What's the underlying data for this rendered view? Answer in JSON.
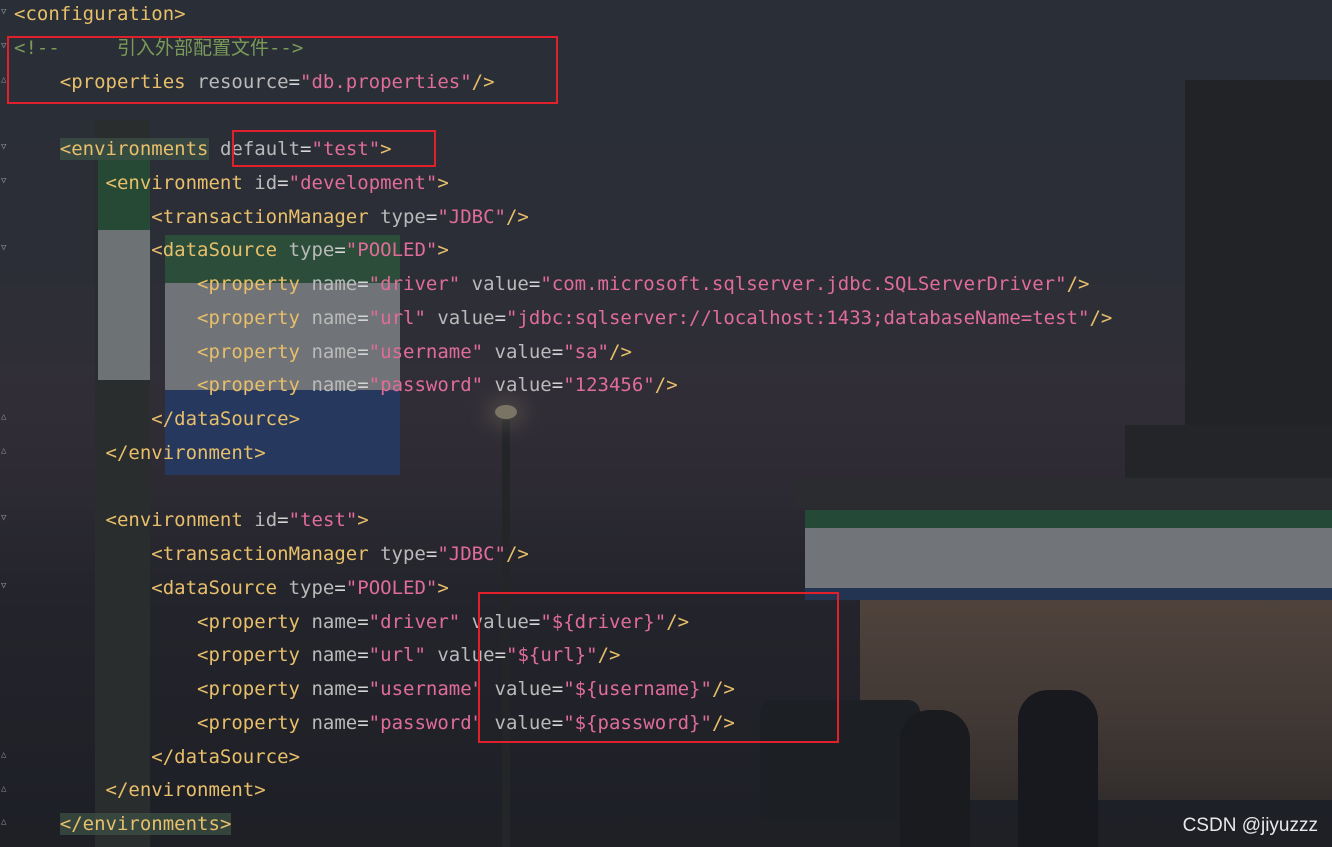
{
  "lines": [
    {
      "indent": 0,
      "open": "<",
      "tag": "configuration",
      "close": ">"
    },
    {
      "indent": 0,
      "comment": "<!--     引入外部配置文件-->"
    },
    {
      "indent": 4,
      "open": "<",
      "tag": "properties",
      "attrs": [
        [
          "resource",
          "db.properties"
        ]
      ],
      "close": "/>"
    },
    {
      "indent": 0,
      "blank": true
    },
    {
      "indent": 4,
      "open": "<",
      "tag": "environments",
      "attrs": [
        [
          "default",
          "test"
        ]
      ],
      "close": ">"
    },
    {
      "indent": 8,
      "open": "<",
      "tag": "environment",
      "attrs": [
        [
          "id",
          "development"
        ]
      ],
      "close": ">"
    },
    {
      "indent": 12,
      "open": "<",
      "tag": "transactionManager",
      "attrs": [
        [
          "type",
          "JDBC"
        ]
      ],
      "close": "/>"
    },
    {
      "indent": 12,
      "open": "<",
      "tag": "dataSource",
      "attrs": [
        [
          "type",
          "POOLED"
        ]
      ],
      "close": ">"
    },
    {
      "indent": 16,
      "open": "<",
      "tag": "property",
      "attrs": [
        [
          "name",
          "driver"
        ],
        [
          "value",
          "com.microsoft.sqlserver.jdbc.SQLServerDriver"
        ]
      ],
      "close": "/>"
    },
    {
      "indent": 16,
      "open": "<",
      "tag": "property",
      "attrs": [
        [
          "name",
          "url"
        ],
        [
          "value",
          "jdbc:sqlserver://localhost:1433;databaseName=test"
        ]
      ],
      "close": "/>"
    },
    {
      "indent": 16,
      "open": "<",
      "tag": "property",
      "attrs": [
        [
          "name",
          "username"
        ],
        [
          "value",
          "sa"
        ]
      ],
      "close": "/>"
    },
    {
      "indent": 16,
      "open": "<",
      "tag": "property",
      "attrs": [
        [
          "name",
          "password"
        ],
        [
          "value",
          "123456"
        ]
      ],
      "close": "/>"
    },
    {
      "indent": 12,
      "open": "</",
      "tag": "dataSource",
      "close": ">"
    },
    {
      "indent": 8,
      "open": "</",
      "tag": "environment",
      "close": ">"
    },
    {
      "indent": 0,
      "blank": true
    },
    {
      "indent": 8,
      "open": "<",
      "tag": "environment",
      "attrs": [
        [
          "id",
          "test"
        ]
      ],
      "close": ">"
    },
    {
      "indent": 12,
      "open": "<",
      "tag": "transactionManager",
      "attrs": [
        [
          "type",
          "JDBC"
        ]
      ],
      "close": "/>"
    },
    {
      "indent": 12,
      "open": "<",
      "tag": "dataSource",
      "attrs": [
        [
          "type",
          "POOLED"
        ]
      ],
      "close": ">"
    },
    {
      "indent": 16,
      "open": "<",
      "tag": "property",
      "attrs": [
        [
          "name",
          "driver"
        ],
        [
          "value",
          "${driver}"
        ]
      ],
      "close": "/>"
    },
    {
      "indent": 16,
      "open": "<",
      "tag": "property",
      "attrs": [
        [
          "name",
          "url"
        ],
        [
          "value",
          "${url}"
        ]
      ],
      "close": "/>"
    },
    {
      "indent": 16,
      "open": "<",
      "tag": "property",
      "attrs": [
        [
          "name",
          "username"
        ],
        [
          "value",
          "${username}"
        ]
      ],
      "close": "/>"
    },
    {
      "indent": 16,
      "open": "<",
      "tag": "property",
      "attrs": [
        [
          "name",
          "password"
        ],
        [
          "value",
          "${password}"
        ]
      ],
      "close": "/>"
    },
    {
      "indent": 12,
      "open": "</",
      "tag": "dataSource",
      "close": ">"
    },
    {
      "indent": 8,
      "open": "</",
      "tag": "environment",
      "close": ">"
    },
    {
      "indent": 4,
      "open": "</",
      "tag": "environments",
      "close": ">"
    }
  ],
  "watermark": "CSDN @jiyuzzz",
  "colors": {
    "tag": "#e8bf6a",
    "attribute": "#bababa",
    "value": "#e06c9a",
    "comment": "#7a9a5a",
    "highlight_box": "#e0202a"
  }
}
